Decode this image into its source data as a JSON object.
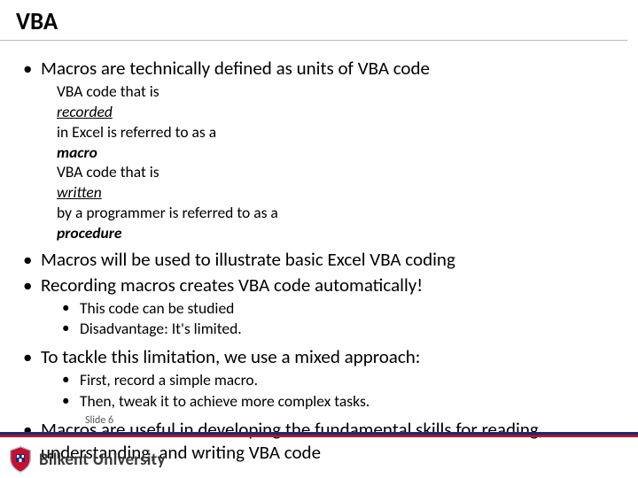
{
  "title": "VBA",
  "bullets": {
    "b1": "Macros are technically defined as units of VBA code",
    "b1a_pre": "VBA code that is ",
    "b1a_rec": "recorded",
    "b1a_mid": " in Excel is referred to as a ",
    "b1a_macro": "macro",
    "b1b_pre": "VBA code that is ",
    "b1b_wr": "written",
    "b1b_mid": " by a programmer is referred to as a ",
    "b1b_proc": "procedure",
    "b2": "Macros will be used to illustrate basic Excel VBA coding",
    "b3": "Recording macros creates VBA code automatically!",
    "b3a": "This code can be studied",
    "b3b": "Disadvantage: It's limited.",
    "b4": "To tackle this limitation, we use a mixed approach:",
    "b4a": "First, record a simple macro.",
    "b4b": "Then, tweak it to achieve more complex tasks.",
    "b5": "Macros are useful in developing the fundamental skills for reading, understanding, and writing VBA code"
  },
  "footer": {
    "slide_label": "Slide 6",
    "university": "Bilkent University"
  },
  "colors": {
    "bar_navy": "#1e2a6c",
    "bar_red": "#c8102e"
  }
}
